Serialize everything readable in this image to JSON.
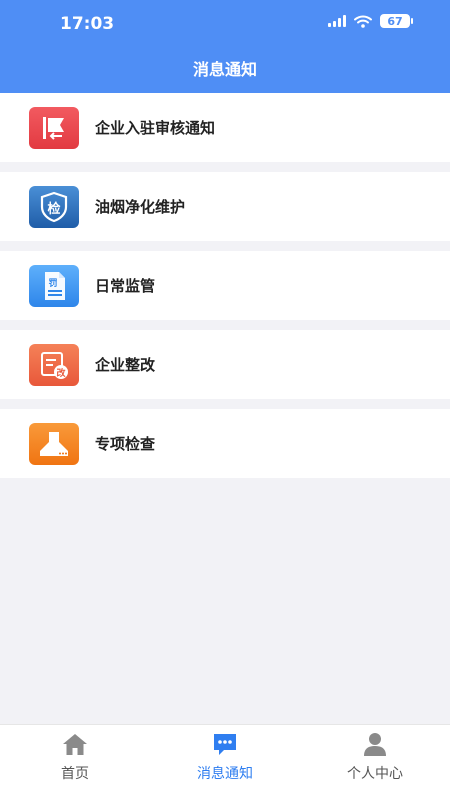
{
  "status_bar": {
    "time": "17:03",
    "battery": "67"
  },
  "header": {
    "title": "消息通知"
  },
  "items": [
    {
      "label": "企业入驻审核通知",
      "icon": "flag-icon",
      "color": "#e9434a"
    },
    {
      "label": "油烟净化维护",
      "icon": "inspection-shield-icon",
      "glyph": "检",
      "color": "#2f6fb8"
    },
    {
      "label": "日常监管",
      "icon": "penalty-document-icon",
      "glyph": "罚",
      "color": "#3d97ef"
    },
    {
      "label": "企业整改",
      "icon": "rectification-document-icon",
      "glyph": "改",
      "color": "#ef6a43"
    },
    {
      "label": "专项检查",
      "icon": "range-hood-icon",
      "color": "#f58220"
    }
  ],
  "tabbar": {
    "tabs": [
      {
        "label": "首页",
        "icon": "home-icon"
      },
      {
        "label": "消息通知",
        "icon": "message-icon",
        "active": true
      },
      {
        "label": "个人中心",
        "icon": "user-icon"
      }
    ]
  },
  "colors": {
    "header": "#4f8ef5",
    "active_tab": "#2f7ef0",
    "inactive_tab": "#8a8a8a"
  }
}
